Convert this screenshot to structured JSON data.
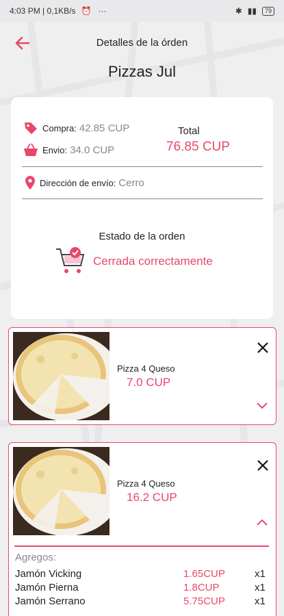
{
  "status_bar": {
    "time": "4:03 PM | 0,1KB/s",
    "dots": "···",
    "battery": "79"
  },
  "header": {
    "title": "Detalles de la órden"
  },
  "store": {
    "name": "Pizzas Jul"
  },
  "summary": {
    "compra_label": "Compra:",
    "compra_value": "42.85 CUP",
    "envio_label": "Envio:",
    "envio_value": "34.0 CUP",
    "total_label": "Total",
    "total_value": "76.85 CUP",
    "direccion_label": "Dirección de envío:",
    "direccion_value": "Cerro"
  },
  "estado": {
    "label": "Estado de la orden",
    "value": "Cerrada correctamente"
  },
  "items": [
    {
      "name": "Pizza 4 Queso",
      "price": "7.0 CUP"
    },
    {
      "name": "Pizza 4 Queso",
      "price": "16.2 CUP"
    }
  ],
  "agregos": {
    "title": "Agregos:",
    "rows": [
      {
        "name": "Jamón Vicking",
        "price": "1.65CUP",
        "qty": "x1"
      },
      {
        "name": "Jamón Pierna",
        "price": "1.8CUP",
        "qty": "x1"
      },
      {
        "name": "Jamón Serrano",
        "price": "5.75CUP",
        "qty": "x1"
      }
    ]
  },
  "colors": {
    "accent": "#e8476a",
    "background": "#f0eff0"
  },
  "icons": [
    "back-arrow-icon",
    "tag-icon",
    "basket-icon",
    "location-pin-icon",
    "cart-check-icon",
    "close-icon",
    "chevron-down-icon",
    "chevron-up-icon"
  ]
}
